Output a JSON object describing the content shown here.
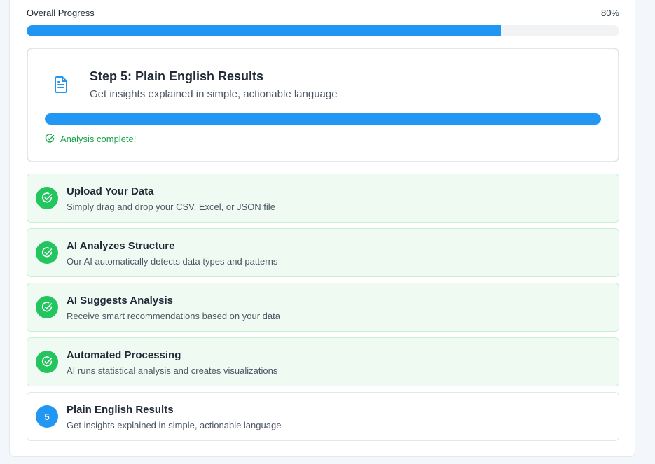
{
  "overall": {
    "label": "Overall Progress",
    "percent_text": "80%",
    "percent": 80
  },
  "current_step": {
    "icon": "document-icon",
    "title": "Step 5: Plain English Results",
    "subtitle": "Get insights explained in simple, actionable language",
    "progress_percent": 100,
    "status_icon": "check-circle-icon",
    "status": "Analysis complete!"
  },
  "steps": [
    {
      "badge": "",
      "icon": "check-circle-icon",
      "state": "complete",
      "title": "Upload Your Data",
      "description": "Simply drag and drop your CSV, Excel, or JSON file"
    },
    {
      "badge": "",
      "icon": "check-circle-icon",
      "state": "complete",
      "title": "AI Analyzes Structure",
      "description": "Our AI automatically detects data types and patterns"
    },
    {
      "badge": "",
      "icon": "check-circle-icon",
      "state": "complete",
      "title": "AI Suggests Analysis",
      "description": "Receive smart recommendations based on your data"
    },
    {
      "badge": "",
      "icon": "check-circle-icon",
      "state": "complete",
      "title": "Automated Processing",
      "description": "AI runs statistical analysis and creates visualizations"
    },
    {
      "badge": "5",
      "icon": "",
      "state": "current",
      "title": "Plain English Results",
      "description": "Get insights explained in simple, actionable language"
    }
  ],
  "colors": {
    "accent": "#2196f3",
    "success": "#22c55e",
    "success_text": "#16a34a",
    "success_bg": "#effbf2"
  }
}
